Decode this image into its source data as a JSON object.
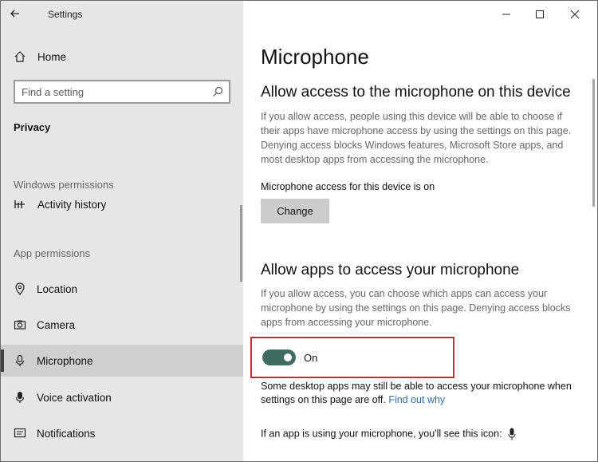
{
  "window": {
    "title": "Settings"
  },
  "sidebar": {
    "home_label": "Home",
    "search_placeholder": "Find a setting",
    "category": "Privacy",
    "windows_permissions_heading": "Windows permissions",
    "windows_items": [
      {
        "label": "Activity history",
        "icon": "activity-history-icon"
      }
    ],
    "app_permissions_heading": "App permissions",
    "app_items": [
      {
        "label": "Location",
        "icon": "location-icon"
      },
      {
        "label": "Camera",
        "icon": "camera-icon"
      },
      {
        "label": "Microphone",
        "icon": "microphone-icon",
        "selected": true
      },
      {
        "label": "Voice activation",
        "icon": "voice-activation-icon"
      },
      {
        "label": "Notifications",
        "icon": "notifications-icon"
      }
    ]
  },
  "content": {
    "page_title": "Microphone",
    "device_section": {
      "heading": "Allow access to the microphone on this device",
      "description": "If you allow access, people using this device will be able to choose if their apps have microphone access by using the settings on this page. Denying access blocks Windows features, Microsoft Store apps, and most desktop apps from accessing the microphone.",
      "status": "Microphone access for this device is on",
      "change_button": "Change"
    },
    "apps_section": {
      "heading": "Allow apps to access your microphone",
      "description": "If you allow access, you can choose which apps can access your microphone by using the settings on this page. Denying access blocks apps from accessing your microphone.",
      "toggle_state": "On",
      "note_text": "Some desktop apps may still be able to access your microphone when settings on this page are off.",
      "note_link": "Find out why",
      "icon_note": "If an app is using your microphone, you'll see this icon:"
    }
  },
  "colors": {
    "sidebar_bg": "#e6e6e6",
    "selected_bg": "#cfcfcf",
    "toggle_on": "#3f6b62",
    "highlight": "#c82a2a",
    "link": "#2b6ea5"
  }
}
